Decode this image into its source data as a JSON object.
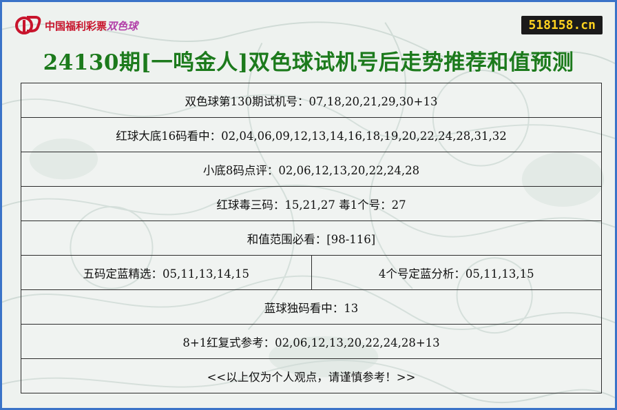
{
  "colors": {
    "frame_border": "#3a73c8",
    "title": "#1c7a1c",
    "badge_bg": "#1b1b1b",
    "badge_text": "#ffd21f",
    "logo_red": "#c8142c",
    "logo_purple": "#b23fa8"
  },
  "logo": {
    "brand": "中国福利彩票",
    "product": "双色球",
    "icon": "welfare-lottery-logo-icon"
  },
  "site": "518158.cn",
  "title": "24130期[一鸣金人]双色球试机号后走势推荐和值预测",
  "rows": {
    "trial_numbers": "双色球第130期试机号：07,18,20,21,29,30+13",
    "red_16": "红球大底16码看中：02,04,06,09,12,13,14,16,18,19,20,22,24,28,31,32",
    "small_8": "小底8码点评：02,06,12,13,20,22,24,28",
    "red_kill": "红球毒三码：15,21,27 毒1个号：27",
    "sum_range": "和值范围必看：[98-116]",
    "blue_five": "五码定蓝精选：05,11,13,14,15",
    "blue_four": "4个号定蓝分析：05,11,13,15",
    "blue_single": "蓝球独码看中：13",
    "compound": "8+1红复式参考：02,06,12,13,20,22,24,28+13",
    "disclaimer": "<<以上仅为个人观点，请谨慎参考！>>"
  }
}
